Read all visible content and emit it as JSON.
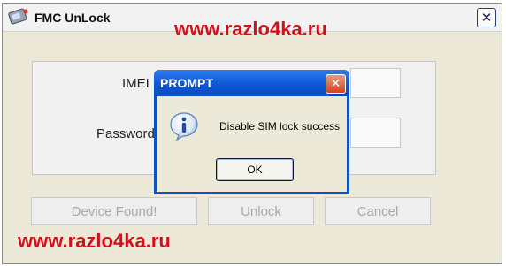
{
  "main_window": {
    "title": "FMC UnLock",
    "close_glyph": "✕",
    "fields": {
      "imei_label": "IMEI",
      "password_label": "Password"
    },
    "buttons": {
      "device_found": "Device Found!",
      "unlock": "Unlock",
      "cancel": "Cancel"
    }
  },
  "watermark": {
    "top": "www.razlo4ka.ru",
    "bottom": "www.razlo4ka.ru",
    "color": "#d0111b"
  },
  "prompt_dialog": {
    "title": "PROMPT",
    "close_glyph": "✕",
    "message": "Disable SIM lock success",
    "ok_label": "OK",
    "icon": "info-icon",
    "title_color": "#0a53c8"
  }
}
